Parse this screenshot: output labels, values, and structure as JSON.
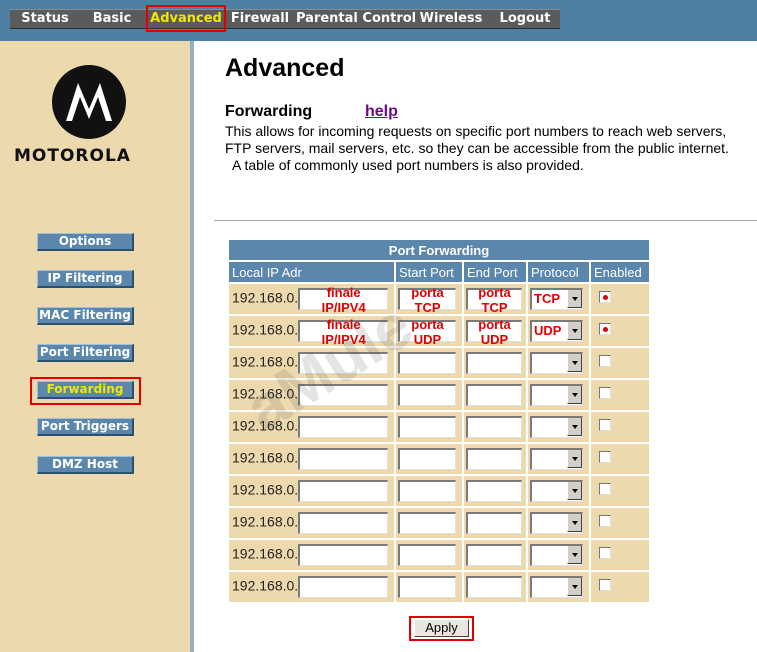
{
  "nav": {
    "items": [
      {
        "label": "Status"
      },
      {
        "label": "Basic"
      },
      {
        "label": "Advanced"
      },
      {
        "label": "Firewall"
      },
      {
        "label": "Parental Control"
      },
      {
        "label": "Wireless"
      },
      {
        "label": "Logout"
      }
    ],
    "active": "Advanced"
  },
  "brand": {
    "logo_text": "MOTOROLA",
    "logo_icon": "motorola-logo-icon"
  },
  "sidebar": {
    "items": [
      {
        "label": "Options"
      },
      {
        "label": "IP Filtering"
      },
      {
        "label": "MAC Filtering"
      },
      {
        "label": "Port Filtering"
      },
      {
        "label": "Forwarding"
      },
      {
        "label": "Port Triggers"
      },
      {
        "label": "DMZ Host"
      }
    ],
    "active": "Forwarding"
  },
  "page": {
    "title": "Advanced",
    "section_title": "Forwarding",
    "help_link": "help",
    "description": [
      "This allows for incoming requests on specific port numbers to reach  web servers,",
      "FTP servers, mail servers, etc. so they can be accessible from the public internet.",
      "  A table of commonly used port numbers is also provided."
    ]
  },
  "table": {
    "caption": "Port Forwarding",
    "headers": [
      "Local IP Adr",
      "Start Port",
      "End Port",
      "Protocol",
      "Enabled"
    ],
    "rows": [
      {
        "ip_prefix": "192.168.0.",
        "ip_note": "finale\nIP/IPV4",
        "start_note": "porta\nTCP",
        "end_note": "porta\nTCP",
        "protocol": "TCP",
        "enabled": true
      },
      {
        "ip_prefix": "192.168.0.",
        "ip_note": "finale\nIP/IPV4",
        "start_note": "porta\nUDP",
        "end_note": "porta\nUDP",
        "protocol": "UDP",
        "enabled": true
      },
      {
        "ip_prefix": "192.168.0.",
        "ip_note": "",
        "start_note": "",
        "end_note": "",
        "protocol": "",
        "enabled": false
      },
      {
        "ip_prefix": "192.168.0.",
        "ip_note": "",
        "start_note": "",
        "end_note": "",
        "protocol": "",
        "enabled": false
      },
      {
        "ip_prefix": "192.168.0.",
        "ip_note": "",
        "start_note": "",
        "end_note": "",
        "protocol": "",
        "enabled": false
      },
      {
        "ip_prefix": "192.168.0.",
        "ip_note": "",
        "start_note": "",
        "end_note": "",
        "protocol": "",
        "enabled": false
      },
      {
        "ip_prefix": "192.168.0.",
        "ip_note": "",
        "start_note": "",
        "end_note": "",
        "protocol": "",
        "enabled": false
      },
      {
        "ip_prefix": "192.168.0.",
        "ip_note": "",
        "start_note": "",
        "end_note": "",
        "protocol": "",
        "enabled": false
      },
      {
        "ip_prefix": "192.168.0.",
        "ip_note": "",
        "start_note": "",
        "end_note": "",
        "protocol": "",
        "enabled": false
      },
      {
        "ip_prefix": "192.168.0.",
        "ip_note": "",
        "start_note": "",
        "end_note": "",
        "protocol": "",
        "enabled": false
      }
    ]
  },
  "apply_label": "Apply",
  "watermark_text": "aMule",
  "colors": {
    "topbar": "#4f7fa3",
    "sidebar": "#ecd9ad",
    "button_blue": "#5b87ad",
    "active_text": "#f2e700",
    "highlight_red": "#e00000"
  }
}
